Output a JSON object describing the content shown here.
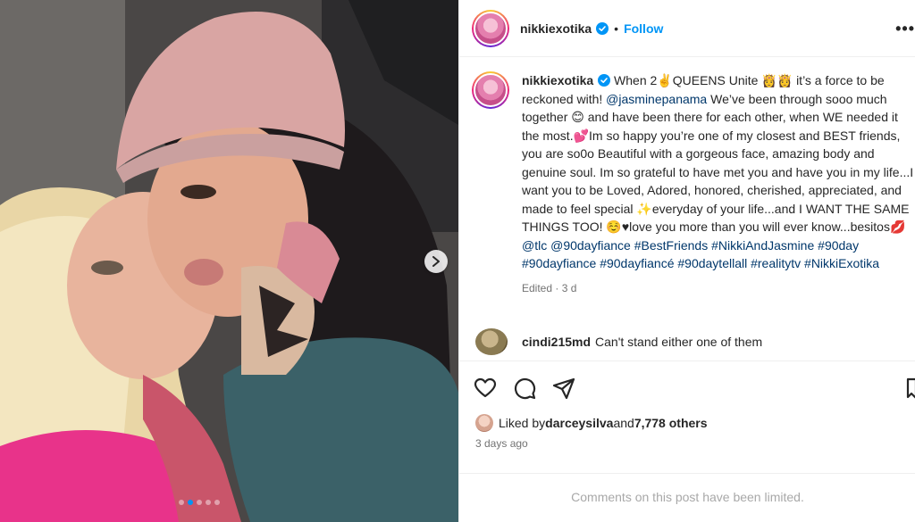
{
  "post": {
    "author": "nikkiexotika",
    "follow_label": "Follow",
    "more_label": "•••",
    "separator": "•"
  },
  "caption": {
    "author": "nikkiexotika",
    "part1": " When 2✌️QUEENS Unite 👸👸 it’s a force to be reckoned with! ",
    "mention": "@jasminepanama",
    "part2": " We’ve been through sooo much together 😊 and have been there for each other, when WE needed it the most.💕Im so happy you’re one of my closest and BEST friends, you are so0o Beautiful with a gorgeous face, amazing body and genuine soul. Im so grateful to have met you and have you in my life...I want you to be Loved, Adored, honored, cherished, appreciated, and made to feel special ✨everyday of your life...and I WANT THE SAME THINGS TOO! ☺️♥love you more than you will ever know...besitos💋 ",
    "tags": [
      "@tlc",
      "@90dayfiance",
      "#BestFriends",
      "#NikkiAndJasmine",
      "#90day",
      "#90dayfiance",
      "#90dayfiancé",
      "#90daytellall",
      "#realitytv",
      "#NikkiExotika"
    ],
    "meta": "Edited · 3 d"
  },
  "comment": {
    "user": "cindi215md",
    "text": "Can't stand either one of them"
  },
  "actions": {
    "icons": [
      "heart-icon",
      "comment-icon",
      "share-icon",
      "bookmark-icon"
    ]
  },
  "likes": {
    "prefix": "Liked by ",
    "user": "darceysilva",
    "middle": " and ",
    "count": "7,778 others"
  },
  "date": "3 days ago",
  "comments_limited": "Comments on this post have been limited.",
  "carousel": {
    "slides": 5,
    "active_index": 1
  },
  "colors": {
    "link": "#0095f6",
    "mention": "#00376b",
    "muted": "#737373"
  }
}
